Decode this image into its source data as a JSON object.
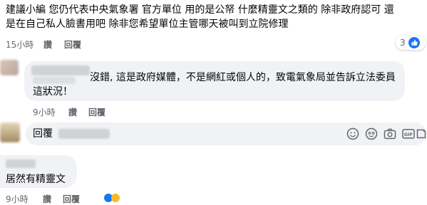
{
  "comment1": {
    "line1": "建議小編 您仍代表中央氣象署 官方單位 用的是公帑 什麼精靈文之類的 除非政府認可 還",
    "line2": "是在自己私人臉書用吧 除非您希望單位主管哪天被叫到立院修理",
    "time": "15小時",
    "like": "讚",
    "reply": "回覆",
    "reaction_count": "3"
  },
  "comment2": {
    "line1": "沒錯, 這是政府媒體，不是網紅或個人的，致電氣象局並告訴立法委員",
    "line2": "這狀況！",
    "time": "9小時",
    "like": "讚",
    "reply": "回覆"
  },
  "reply_box": {
    "label": "回覆"
  },
  "comment3": {
    "text": "居然有精靈文",
    "time": "9小時",
    "like": "讚",
    "reply": "回覆"
  },
  "colors": {
    "bubble": "#f0f2f5",
    "meta": "#65676b",
    "like_blue": "#1877f2",
    "reaction_yellow": "#f7b928"
  }
}
